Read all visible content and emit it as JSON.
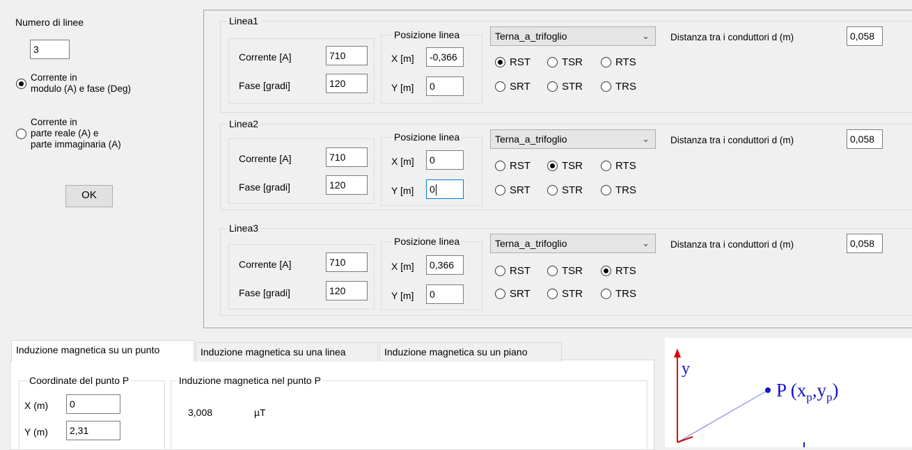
{
  "left_panel": {
    "numero_label": "Numero di linee",
    "numero_value": "3",
    "radio_modulo_line1": "Corrente in",
    "radio_modulo_line2": "modulo (A) e fase (Deg)",
    "radio_reale_line1": "Corrente in",
    "radio_reale_line2": "parte reale (A) e",
    "radio_reale_line3": "parte immaginaria (A)",
    "ok_label": "OK"
  },
  "lines": [
    {
      "title": "Linea1",
      "corrente_label": "Corrente [A]",
      "corrente_value": "710",
      "fase_label": "Fase [gradi]",
      "fase_value": "120",
      "posizione_title": "Posizione linea",
      "x_label": "X [m]",
      "x_value": "-0,366",
      "y_label": "Y [m]",
      "y_value": "0",
      "combo_value": "Terna_a_trifoglio",
      "distanza_label": "Distanza tra i conduttori d (m)",
      "distanza_value": "0,058",
      "phase_options": [
        "RST",
        "TSR",
        "RTS",
        "SRT",
        "STR",
        "TRS"
      ]
    },
    {
      "title": "Linea2",
      "corrente_label": "Corrente [A]",
      "corrente_value": "710",
      "fase_label": "Fase [gradi]",
      "fase_value": "120",
      "posizione_title": "Posizione linea",
      "x_label": "X [m]",
      "x_value": "0",
      "y_label": "Y [m]",
      "y_value": "0",
      "combo_value": "Terna_a_trifoglio",
      "distanza_label": "Distanza tra i conduttori d (m)",
      "distanza_value": "0,058",
      "phase_options": [
        "RST",
        "TSR",
        "RTS",
        "SRT",
        "STR",
        "TRS"
      ]
    },
    {
      "title": "Linea3",
      "corrente_label": "Corrente [A]",
      "corrente_value": "710",
      "fase_label": "Fase [gradi]",
      "fase_value": "120",
      "posizione_title": "Posizione linea",
      "x_label": "X [m]",
      "x_value": "0,366",
      "y_label": "Y [m]",
      "y_value": "0",
      "combo_value": "Terna_a_trifoglio",
      "distanza_label": "Distanza tra i conduttori d (m)",
      "distanza_value": "0,058",
      "phase_options": [
        "RST",
        "TSR",
        "RTS",
        "SRT",
        "STR",
        "TRS"
      ]
    }
  ],
  "selected_phases": [
    "RST",
    "TSR",
    "RTS"
  ],
  "tabs": [
    "Induzione magnetica su un punto",
    "Induzione magnetica su una linea",
    "Induzione magnetica su un piano"
  ],
  "punto": {
    "coord_title": "Coordinate del punto P",
    "x_label": "X (m)",
    "x_value": "0",
    "y_label": "Y (m)",
    "y_value": "2,31",
    "induzione_title": "Induzione magnetica nel punto P",
    "result_value": "3,008",
    "result_unit": "µT"
  },
  "diagram": {
    "y_axis_label": "y",
    "point_label": "P (x",
    "sub_p": "p",
    "comma": ",y",
    "close": ")"
  },
  "colors": {
    "accent": "#0078d7",
    "diagram": "#1515c8",
    "axis_red": "#e00000"
  }
}
